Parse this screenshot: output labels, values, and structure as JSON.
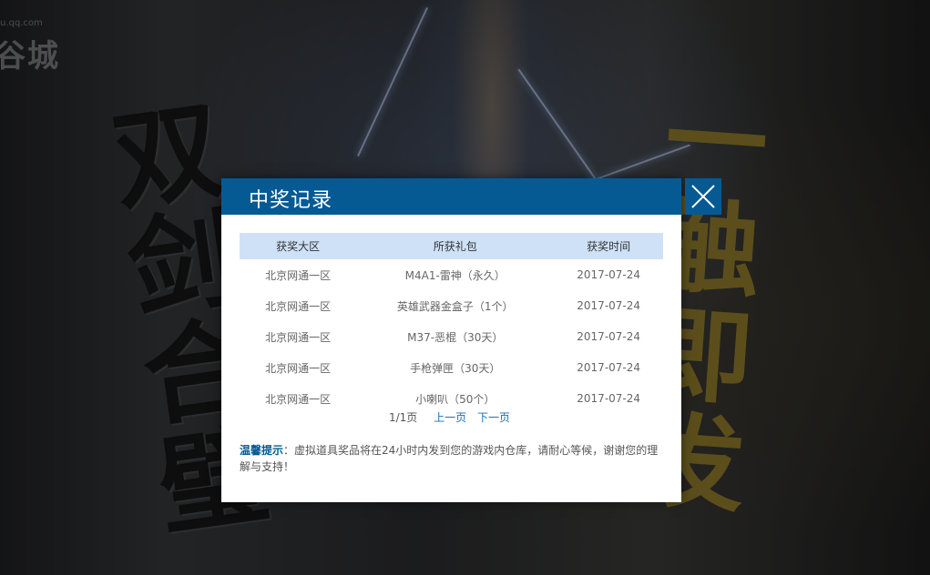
{
  "background": {
    "url_text": "u.qq.com",
    "logo_text": "谷城",
    "left_title": "双剑合璧",
    "right_title": "一触即发"
  },
  "dialog": {
    "title": "中奖记录",
    "close_icon": "close-icon",
    "table": {
      "headers": [
        "获奖大区",
        "所获礼包",
        "获奖时间"
      ],
      "rows": [
        [
          "北京网通一区",
          "M4A1-雷神（永久）",
          "2017-07-24"
        ],
        [
          "北京网通一区",
          "英雄武器金盒子（1个）",
          "2017-07-24"
        ],
        [
          "北京网通一区",
          "M37-恶棍（30天）",
          "2017-07-24"
        ],
        [
          "北京网通一区",
          "手枪弹匣（30天）",
          "2017-07-24"
        ],
        [
          "北京网通一区",
          "小喇叭（50个）",
          "2017-07-24"
        ]
      ]
    },
    "pager": {
      "page_info": "1/1页",
      "prev": "上一页",
      "next": "下一页"
    },
    "tip": {
      "label": "温馨提示",
      "text": "：虚拟道具奖品将在24小时内发到您的游戏内仓库，请耐心等候，谢谢您的理解与支持！"
    }
  },
  "colors": {
    "header_bg": "#065a94",
    "table_header_bg": "#cfe1f7",
    "link": "#1a6fb5"
  }
}
